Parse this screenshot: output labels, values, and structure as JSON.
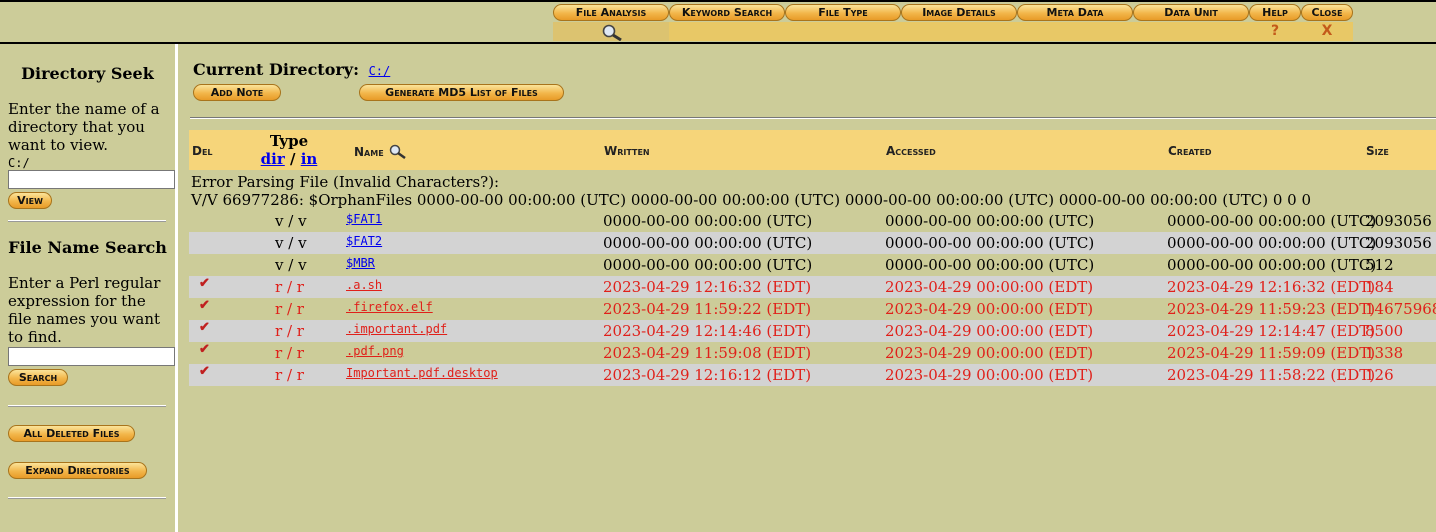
{
  "nav": {
    "tabs": [
      {
        "label": "File Analysis",
        "mark": "",
        "active": true
      },
      {
        "label": "Keyword Search",
        "mark": ""
      },
      {
        "label": "File Type",
        "mark": ""
      },
      {
        "label": "Image Details",
        "mark": ""
      },
      {
        "label": "Meta Data",
        "mark": ""
      },
      {
        "label": "Data Unit",
        "mark": ""
      },
      {
        "label": "Help",
        "mark": "?"
      },
      {
        "label": "Close",
        "mark": "X"
      }
    ]
  },
  "sidebar": {
    "dir_seek": {
      "title": "Directory Seek",
      "description": "Enter the name of a directory that you want to view.",
      "current": "C:/",
      "input_value": "",
      "button": "View"
    },
    "name_search": {
      "title": "File Name Search",
      "description": "Enter a Perl regular expression for the file names you want to find.",
      "input_value": "",
      "button": "Search"
    },
    "all_deleted_button": "All Deleted Files",
    "expand_dirs_button": "Expand Directories"
  },
  "main": {
    "current_dir_label": "Current Directory:",
    "current_dir": "C:/",
    "add_note_button": "Add Note",
    "md5_button": "Generate MD5 List of Files",
    "columns": {
      "del": "Del",
      "type": "Type",
      "type_dir": "dir",
      "type_sep": "/",
      "type_in": "in",
      "name": "Name",
      "written": "Written",
      "accessed": "Accessed",
      "created": "Created",
      "size": "Size"
    },
    "error_line1": "Error Parsing File (Invalid Characters?):",
    "error_line2": "V/V 66977286: $OrphanFiles 0000-00-00 00:00:00 (UTC) 0000-00-00 00:00:00 (UTC) 0000-00-00 00:00:00 (UTC) 0000-00-00 00:00:00 (UTC) 0 0 0",
    "rows": [
      {
        "del": "",
        "type": "v / v",
        "name": "$FAT1",
        "written": "0000-00-00 00:00:00 (UTC)",
        "accessed": "0000-00-00 00:00:00 (UTC)",
        "created": "0000-00-00 00:00:00 (UTC)",
        "size": "2093056"
      },
      {
        "del": "",
        "type": "v / v",
        "name": "$FAT2",
        "written": "0000-00-00 00:00:00 (UTC)",
        "accessed": "0000-00-00 00:00:00 (UTC)",
        "created": "0000-00-00 00:00:00 (UTC)",
        "size": "2093056"
      },
      {
        "del": "",
        "type": "v / v",
        "name": "$MBR",
        "written": "0000-00-00 00:00:00 (UTC)",
        "accessed": "0000-00-00 00:00:00 (UTC)",
        "created": "0000-00-00 00:00:00 (UTC)",
        "size": "512"
      },
      {
        "del": "✔",
        "type": "r / r",
        "name": ".a.sh",
        "written": "2023-04-29 12:16:32 (EDT)",
        "accessed": "2023-04-29 00:00:00 (EDT)",
        "created": "2023-04-29 12:16:32 (EDT)",
        "size": "184"
      },
      {
        "del": "✔",
        "type": "r / r",
        "name": ".firefox.elf",
        "written": "2023-04-29 11:59:22 (EDT)",
        "accessed": "2023-04-29 00:00:00 (EDT)",
        "created": "2023-04-29 11:59:23 (EDT)",
        "size": "14675968"
      },
      {
        "del": "✔",
        "type": "r / r",
        "name": ".important.pdf",
        "written": "2023-04-29 12:14:46 (EDT)",
        "accessed": "2023-04-29 00:00:00 (EDT)",
        "created": "2023-04-29 12:14:47 (EDT)",
        "size": "8500"
      },
      {
        "del": "✔",
        "type": "r / r",
        "name": ".pdf.png",
        "written": "2023-04-29 11:59:08 (EDT)",
        "accessed": "2023-04-29 00:00:00 (EDT)",
        "created": "2023-04-29 11:59:09 (EDT)",
        "size": "1338"
      },
      {
        "del": "✔",
        "type": "r / r",
        "name": "Important.pdf.desktop",
        "written": "2023-04-29 12:16:12 (EDT)",
        "accessed": "2023-04-29 00:00:00 (EDT)",
        "created": "2023-04-29 11:58:22 (EDT)",
        "size": "126"
      }
    ]
  },
  "colors": {
    "background": "#cccc99",
    "header_row": "#f6d57a",
    "shaded_row": "#d3d3d3",
    "deleted_text": "#e0201a",
    "link": "#0000ee"
  }
}
